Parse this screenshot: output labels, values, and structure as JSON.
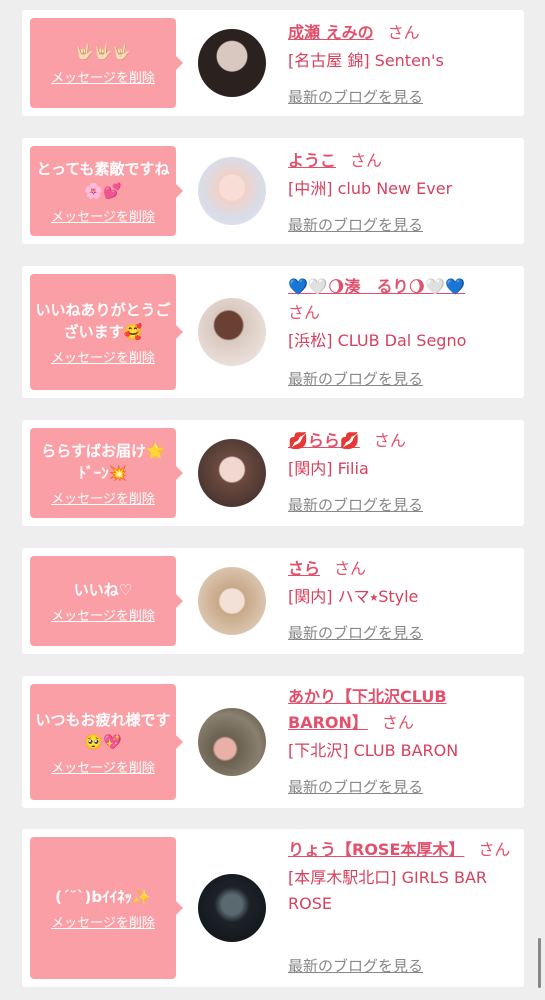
{
  "cards": [
    {
      "message": "🤟🏻🤟🏻🤟🏻",
      "delete": "メッセージを削除",
      "name": "成瀬 えみの",
      "san": "さん",
      "shop": "[名古屋 錦] Senten's",
      "blog": "最新のブログを見る"
    },
    {
      "message": "とっても素敵ですね🌸💕",
      "delete": "メッセージを削除",
      "name": "ようこ",
      "san": "さん",
      "shop": "[中洲] club New Ever",
      "blog": "最新のブログを見る"
    },
    {
      "message": "いいねありがとうございます🥰",
      "delete": "メッセージを削除",
      "name": "💙🤍🌖湊　るり🌖🤍💙",
      "san": "さん",
      "shop": "[浜松] CLUB Dal Segno",
      "blog": "最新のブログを見る"
    },
    {
      "message": "ららすばお届け🌟ﾄﾞｰﾝ💥",
      "delete": "メッセージを削除",
      "name": "💋らら💋",
      "san": "さん",
      "shop": "[関内] Filia",
      "blog": "最新のブログを見る"
    },
    {
      "message": "いいね♡",
      "delete": "メッセージを削除",
      "name": "さら",
      "san": "さん",
      "shop": "[関内] ハマ⭑Style",
      "blog": "最新のブログを見る"
    },
    {
      "message": "いつもお疲れ様です🥺💖",
      "delete": "メッセージを削除",
      "name": "あかり【下北沢CLUB BARON】",
      "san": "さん",
      "shop": "[下北沢] CLUB BARON",
      "blog": "最新のブログを見る"
    },
    {
      "message": "(ˊ˘ˋ)bｲｲﾈｯ✨",
      "delete": "メッセージを削除",
      "name": "りょう【ROSE本厚木】",
      "san": "さん",
      "shop": "[本厚木駅北口] GIRLS BAR ROSE",
      "blog": "最新のブログを見る"
    }
  ],
  "colors": {
    "bubble": "#fb9fa6",
    "name": "#e3506b",
    "shop": "#d8405e",
    "link": "#888888"
  }
}
